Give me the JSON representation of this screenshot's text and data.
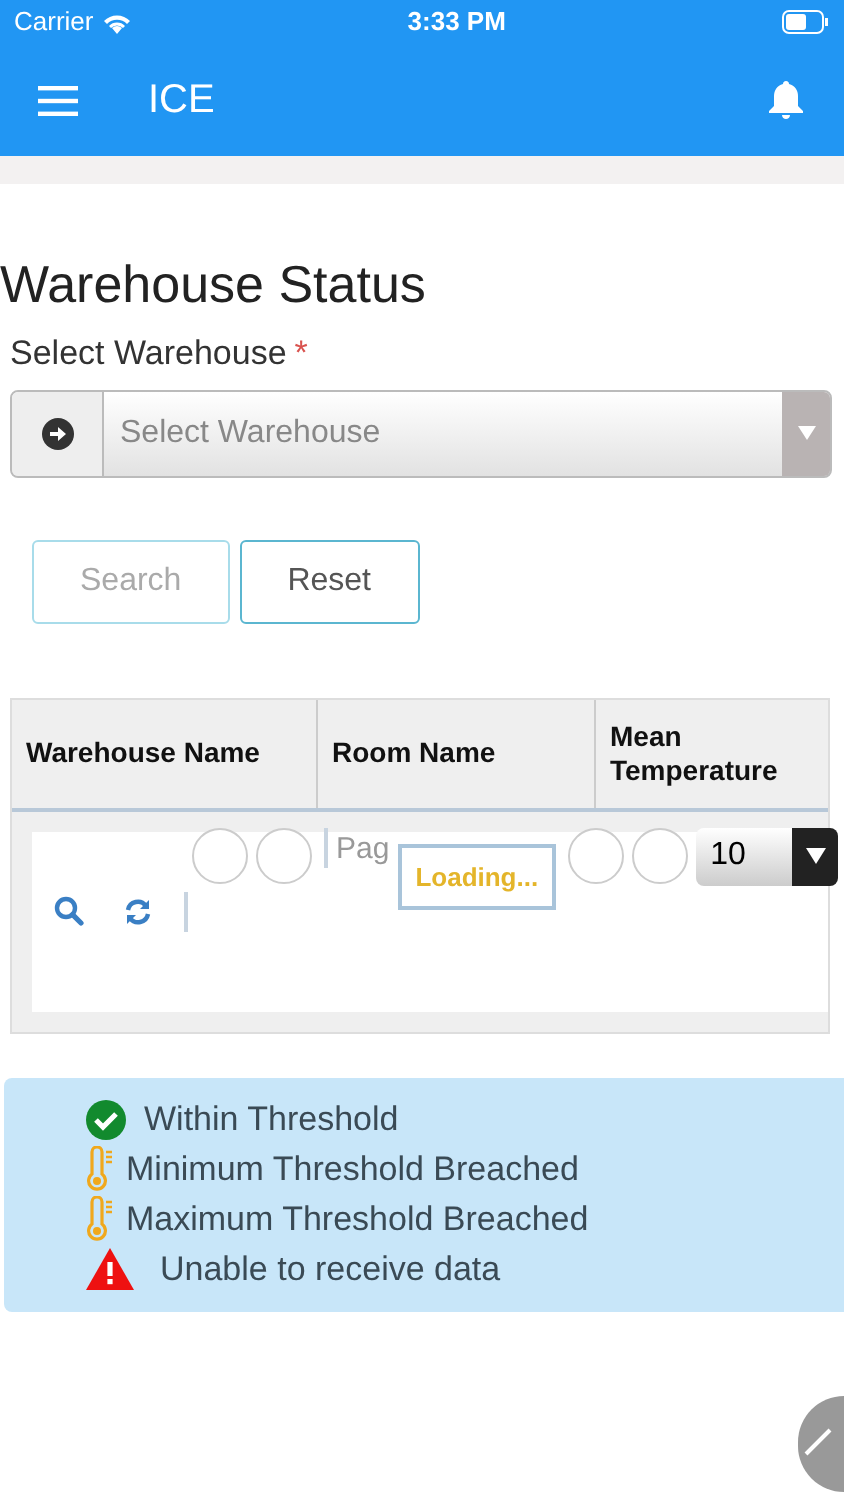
{
  "status_bar": {
    "carrier": "Carrier",
    "time": "3:33 PM"
  },
  "app_bar": {
    "title": "ICE"
  },
  "page_title": "Warehouse Status",
  "warehouse_field": {
    "label": "Select Warehouse",
    "required_mark": "*",
    "placeholder": "Select Warehouse"
  },
  "buttons": [
    {
      "label": "Search",
      "disabled": true
    },
    {
      "label": "Reset",
      "disabled": false
    }
  ],
  "table": {
    "columns": [
      "Warehouse Name",
      "Room Name",
      "Mean Temperature"
    ],
    "pager": {
      "page_label": "Pag",
      "loading": "Loading...",
      "page_size": "10"
    }
  },
  "legend": [
    {
      "kind": "check",
      "label": "Within Threshold"
    },
    {
      "kind": "thermometer",
      "label": "Minimum Threshold Breached"
    },
    {
      "kind": "thermometer",
      "label": "Maximum Threshold Breached"
    },
    {
      "kind": "warning",
      "label": "Unable to receive data"
    }
  ]
}
